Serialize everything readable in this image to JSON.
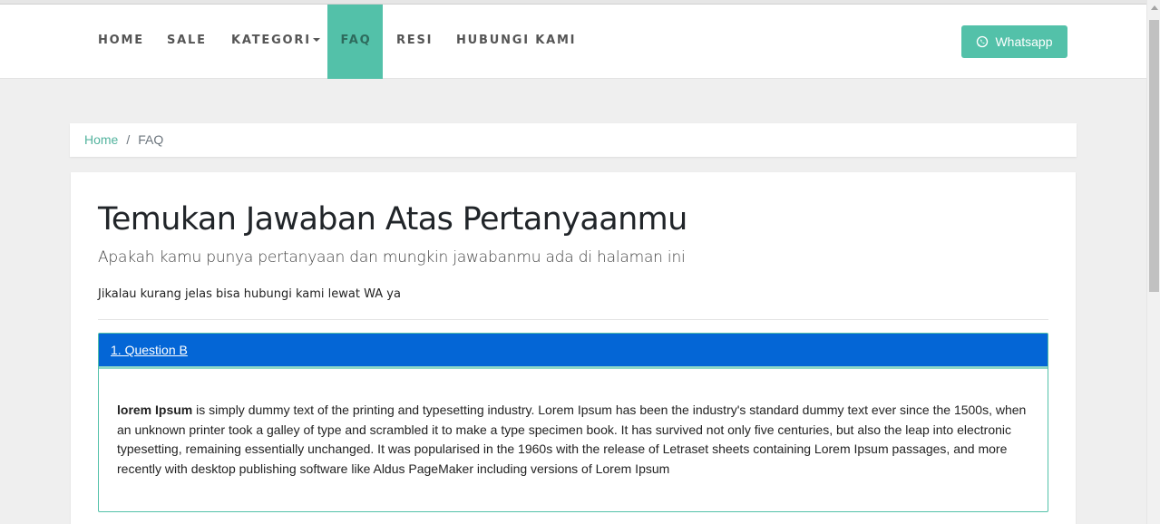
{
  "nav": {
    "items": [
      "HOME",
      "SALE",
      "KATEGORI",
      "FAQ",
      "RESI",
      "HUBUNGI KAMI"
    ],
    "active": "FAQ"
  },
  "whatsapp_button": {
    "label": "Whatsapp",
    "icon": "whatsapp-icon"
  },
  "breadcrumb": {
    "home": "Home",
    "separator": "/",
    "current": "FAQ"
  },
  "page": {
    "title": "Temukan Jawaban Atas Pertanyaanmu",
    "subtitle": "Apakah kamu punya pertanyaan dan mungkin jawabanmu ada di halaman ini",
    "note": "Jikalau kurang jelas bisa hubungi kami lewat WA ya"
  },
  "faq": [
    {
      "question": "1. Question B",
      "answer_bold": "lorem Ipsum",
      "answer_rest": " is simply dummy text of the printing and typesetting industry. Lorem Ipsum has been the industry's standard dummy text ever since the 1500s, when an unknown printer took a galley of type and scrambled it to make a type specimen book. It has survived not only five centuries, but also the leap into electronic typesetting, remaining essentially unchanged. It was popularised in the 1960s with the release of Letraset sheets containing Lorem Ipsum passages, and more recently with desktop publishing software like Aldus PageMaker including versions of Lorem Ipsum"
    }
  ],
  "colors": {
    "accent": "#53c1a9",
    "faq_header": "#0466d6",
    "background": "#efefef"
  }
}
